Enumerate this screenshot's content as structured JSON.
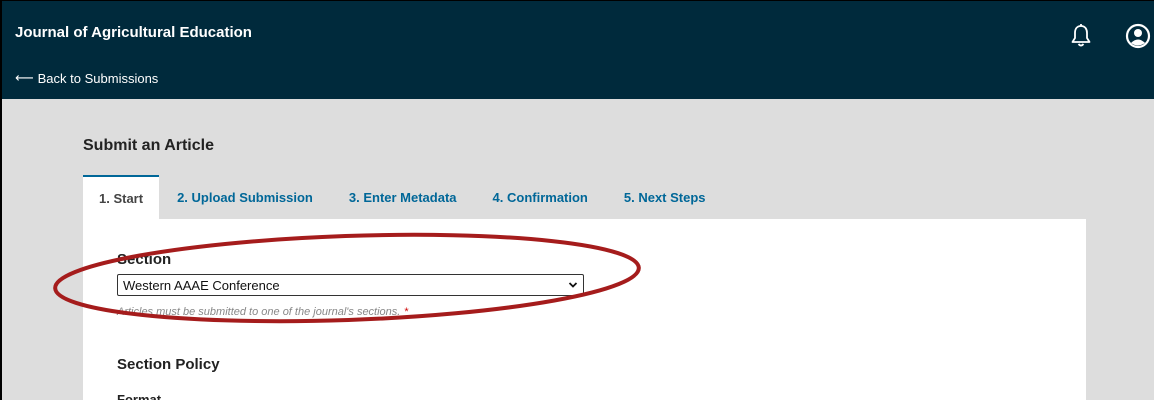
{
  "header": {
    "journal_title": "Journal of Agricultural Education",
    "back_arrow": "⟵",
    "back_label": "Back to Submissions",
    "icons": [
      "bell-icon",
      "user-icon"
    ]
  },
  "page": {
    "title": "Submit an Article"
  },
  "tabs": [
    {
      "label": "1. Start",
      "active": true
    },
    {
      "label": "2. Upload Submission",
      "active": false
    },
    {
      "label": "3. Enter Metadata",
      "active": false
    },
    {
      "label": "4. Confirmation",
      "active": false
    },
    {
      "label": "5. Next Steps",
      "active": false
    }
  ],
  "form": {
    "section_label": "Section",
    "section_value": "Western AAAE Conference",
    "section_help": "Articles must be submitted to one of the journal's sections.",
    "required_mark": "*",
    "policy_title": "Section Policy",
    "format_label": "Format"
  },
  "colors": {
    "header_bg": "#002a3c",
    "link": "#006798",
    "content_bg": "#dddddd",
    "annotation": "#a51c1c",
    "required": "#d00a0a"
  }
}
